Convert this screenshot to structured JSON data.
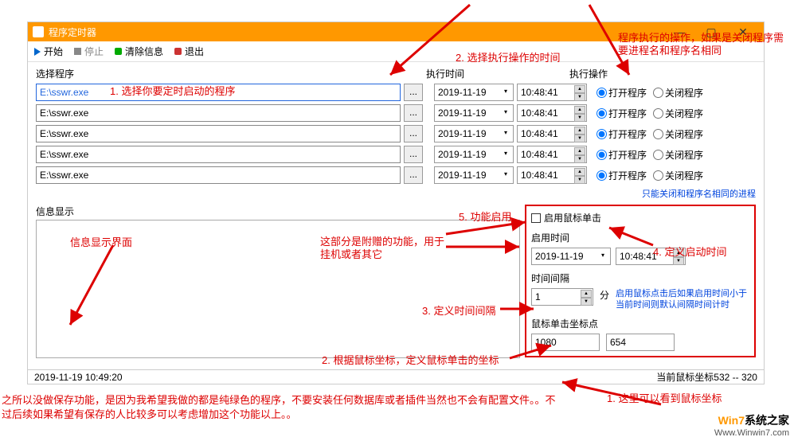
{
  "titlebar": {
    "title": "程序定时器"
  },
  "toolbar": {
    "start": "开始",
    "stop": "停止",
    "clear": "清除信息",
    "exit": "退出"
  },
  "headers": {
    "program": "选择程序",
    "exectime": "执行时间",
    "action": "执行操作"
  },
  "rows": [
    {
      "path": "E:\\sswr.exe",
      "date": "2019-11-19",
      "time": "10:48:41",
      "open": "打开程序",
      "close": "关闭程序"
    },
    {
      "path": "E:\\sswr.exe",
      "date": "2019-11-19",
      "time": "10:48:41",
      "open": "打开程序",
      "close": "关闭程序"
    },
    {
      "path": "E:\\sswr.exe",
      "date": "2019-11-19",
      "time": "10:48:41",
      "open": "打开程序",
      "close": "关闭程序"
    },
    {
      "path": "E:\\sswr.exe",
      "date": "2019-11-19",
      "time": "10:48:41",
      "open": "打开程序",
      "close": "关闭程序"
    },
    {
      "path": "E:\\sswr.exe",
      "date": "2019-11-19",
      "time": "10:48:41",
      "open": "打开程序",
      "close": "关闭程序"
    }
  ],
  "note_closeonly": "只能关闭和程序名相同的进程",
  "info_label": "信息显示",
  "mouse": {
    "enable": "启用鼠标单击",
    "starttime": "启用时间",
    "date": "2019-11-19",
    "time": "10:48:41",
    "interval_label": "时间间隔",
    "interval": "1",
    "interval_unit": "分",
    "note": "启用鼠标点击后如果启用时间小于当前时间则默认间隔时间计时",
    "coord_label": "鼠标单击坐标点",
    "x": "1080",
    "y": "654"
  },
  "status": {
    "left": "2019-11-19 10:49:20",
    "right": "当前鼠标坐标532 -- 320"
  },
  "annotations": {
    "a1": "1. 选择你要定时启动的程序",
    "a2": "2. 选择执行操作的时间",
    "a3": "程序执行的操作，如果是关闭程序需要进程名和程序名相同",
    "a5": "5. 功能启用",
    "a_info": "信息显示界面",
    "a_extra": "这部分是附赠的功能，用于挂机或者其它",
    "a4": "4. 定义启动时间",
    "a_int": "3. 定义时间间隔",
    "a_coord": "2. 根据鼠标坐标，定义鼠标单击的坐标",
    "a_mouse": "1. 这里可以看到鼠标坐标",
    "footer": "之所以没做保存功能，是因为我希望我做的都是纯绿色的程序，不要安装任何数据库或者插件当然也不会有配置文件。。不过后续如果希望有保存的人比较多可以考虑增加这个功能以上。。"
  },
  "logo": {
    "line1a": "Win7",
    "line1b": "系统之家",
    "line2": "Www.Winwin7.com"
  }
}
